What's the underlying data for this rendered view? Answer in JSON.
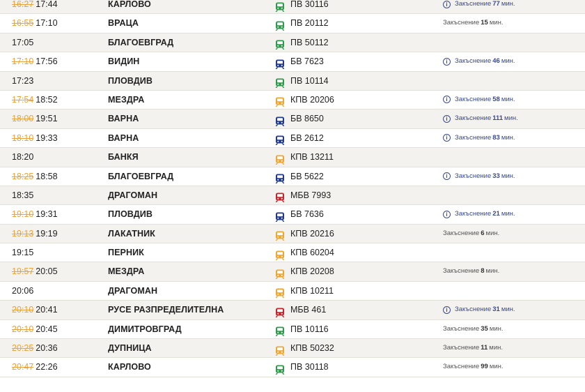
{
  "colors": {
    "green": "#2e9b4a",
    "blue": "#1f3a8f",
    "orange": "#f0a52e",
    "red": "#c9242b",
    "strike": "#e8a33a"
  },
  "rows": [
    {
      "sched": "16:27",
      "actual": "17:44",
      "dest": "КАРЛОВО",
      "icon": "train-icon",
      "color": "green",
      "train": "ПВ 30116",
      "note": {
        "info": true,
        "prefix": "Закъснение",
        "num": "77",
        "suffix": "мин."
      }
    },
    {
      "sched": "16:55",
      "actual": "17:10",
      "dest": "ВРАЦА",
      "icon": "train-icon",
      "color": "green",
      "train": "ПВ 20112",
      "note": {
        "info": false,
        "prefix": "Закъснение",
        "num": "15",
        "suffix": "мин."
      }
    },
    {
      "sched": "",
      "actual": "17:05",
      "dest": "БЛАГОЕВГРАД",
      "icon": "train-icon",
      "color": "green",
      "train": "ПВ 50112",
      "note": null
    },
    {
      "sched": "17:10",
      "actual": "17:56",
      "dest": "ВИДИН",
      "icon": "train-icon",
      "color": "blue",
      "train": "БВ 7623",
      "note": {
        "info": true,
        "prefix": "Закъснение",
        "num": "46",
        "suffix": "мин."
      }
    },
    {
      "sched": "",
      "actual": "17:23",
      "dest": "ПЛОВДИВ",
      "icon": "train-icon",
      "color": "green",
      "train": "ПВ 10114",
      "note": null
    },
    {
      "sched": "17:54",
      "actual": "18:52",
      "dest": "МЕЗДРА",
      "icon": "train-icon",
      "color": "orange",
      "train": "КПВ 20206",
      "note": {
        "info": true,
        "prefix": "Закъснение",
        "num": "58",
        "suffix": "мин."
      }
    },
    {
      "sched": "18:00",
      "actual": "19:51",
      "dest": "ВАРНА",
      "icon": "train-icon",
      "color": "blue",
      "train": "БВ 8650",
      "note": {
        "info": true,
        "prefix": "Закъснение",
        "num": "111",
        "suffix": "мин."
      }
    },
    {
      "sched": "18:10",
      "actual": "19:33",
      "dest": "ВАРНА",
      "icon": "train-icon",
      "color": "blue",
      "train": "БВ 2612",
      "note": {
        "info": true,
        "prefix": "Закъснение",
        "num": "83",
        "suffix": "мин."
      }
    },
    {
      "sched": "",
      "actual": "18:20",
      "dest": "БАНКЯ",
      "icon": "train-icon",
      "color": "orange",
      "train": "КПВ 13211",
      "note": null
    },
    {
      "sched": "18:25",
      "actual": "18:58",
      "dest": "БЛАГОЕВГРАД",
      "icon": "train-icon",
      "color": "blue",
      "train": "БВ 5622",
      "note": {
        "info": true,
        "prefix": "Закъснение",
        "num": "33",
        "suffix": "мин."
      }
    },
    {
      "sched": "",
      "actual": "18:35",
      "dest": "ДРАГОМАН",
      "icon": "train-icon",
      "color": "red",
      "train": "МБВ 7993",
      "note": null
    },
    {
      "sched": "19:10",
      "actual": "19:31",
      "dest": "ПЛОВДИВ",
      "icon": "train-icon",
      "color": "blue",
      "train": "БВ 7636",
      "note": {
        "info": true,
        "prefix": "Закъснение",
        "num": "21",
        "suffix": "мин."
      }
    },
    {
      "sched": "19:13",
      "actual": "19:19",
      "dest": "ЛАКАТНИК",
      "icon": "train-icon",
      "color": "orange",
      "train": "КПВ 20216",
      "note": {
        "info": false,
        "prefix": "Закъснение",
        "num": "6",
        "suffix": "мин."
      }
    },
    {
      "sched": "",
      "actual": "19:15",
      "dest": "ПЕРНИК",
      "icon": "train-icon",
      "color": "orange",
      "train": "КПВ 60204",
      "note": null
    },
    {
      "sched": "19:57",
      "actual": "20:05",
      "dest": "МЕЗДРА",
      "icon": "train-icon",
      "color": "orange",
      "train": "КПВ 20208",
      "note": {
        "info": false,
        "prefix": "Закъснение",
        "num": "8",
        "suffix": "мин."
      }
    },
    {
      "sched": "",
      "actual": "20:06",
      "dest": "ДРАГОМАН",
      "icon": "train-icon",
      "color": "orange",
      "train": "КПВ 10211",
      "note": null
    },
    {
      "sched": "20:10",
      "actual": "20:41",
      "dest": "РУСЕ РАЗПРЕДЕЛИТЕЛНА",
      "icon": "train-icon",
      "color": "red",
      "train": "МБВ 461",
      "note": {
        "info": true,
        "prefix": "Закъснение",
        "num": "31",
        "suffix": "мин."
      }
    },
    {
      "sched": "20:10",
      "actual": "20:45",
      "dest": "ДИМИТРОВГРАД",
      "icon": "train-icon",
      "color": "green",
      "train": "ПВ 10116",
      "note": {
        "info": false,
        "prefix": "Закъснение",
        "num": "35",
        "suffix": "мин."
      }
    },
    {
      "sched": "20:25",
      "actual": "20:36",
      "dest": "ДУПНИЦА",
      "icon": "train-icon",
      "color": "orange",
      "train": "КПВ 50232",
      "note": {
        "info": false,
        "prefix": "Закъснение",
        "num": "11",
        "suffix": "мин."
      }
    },
    {
      "sched": "20:47",
      "actual": "22:26",
      "dest": "КАРЛОВО",
      "icon": "train-icon",
      "color": "green",
      "train": "ПВ 30118",
      "note": {
        "info": false,
        "prefix": "Закъснение",
        "num": "99",
        "suffix": "мин."
      }
    }
  ]
}
